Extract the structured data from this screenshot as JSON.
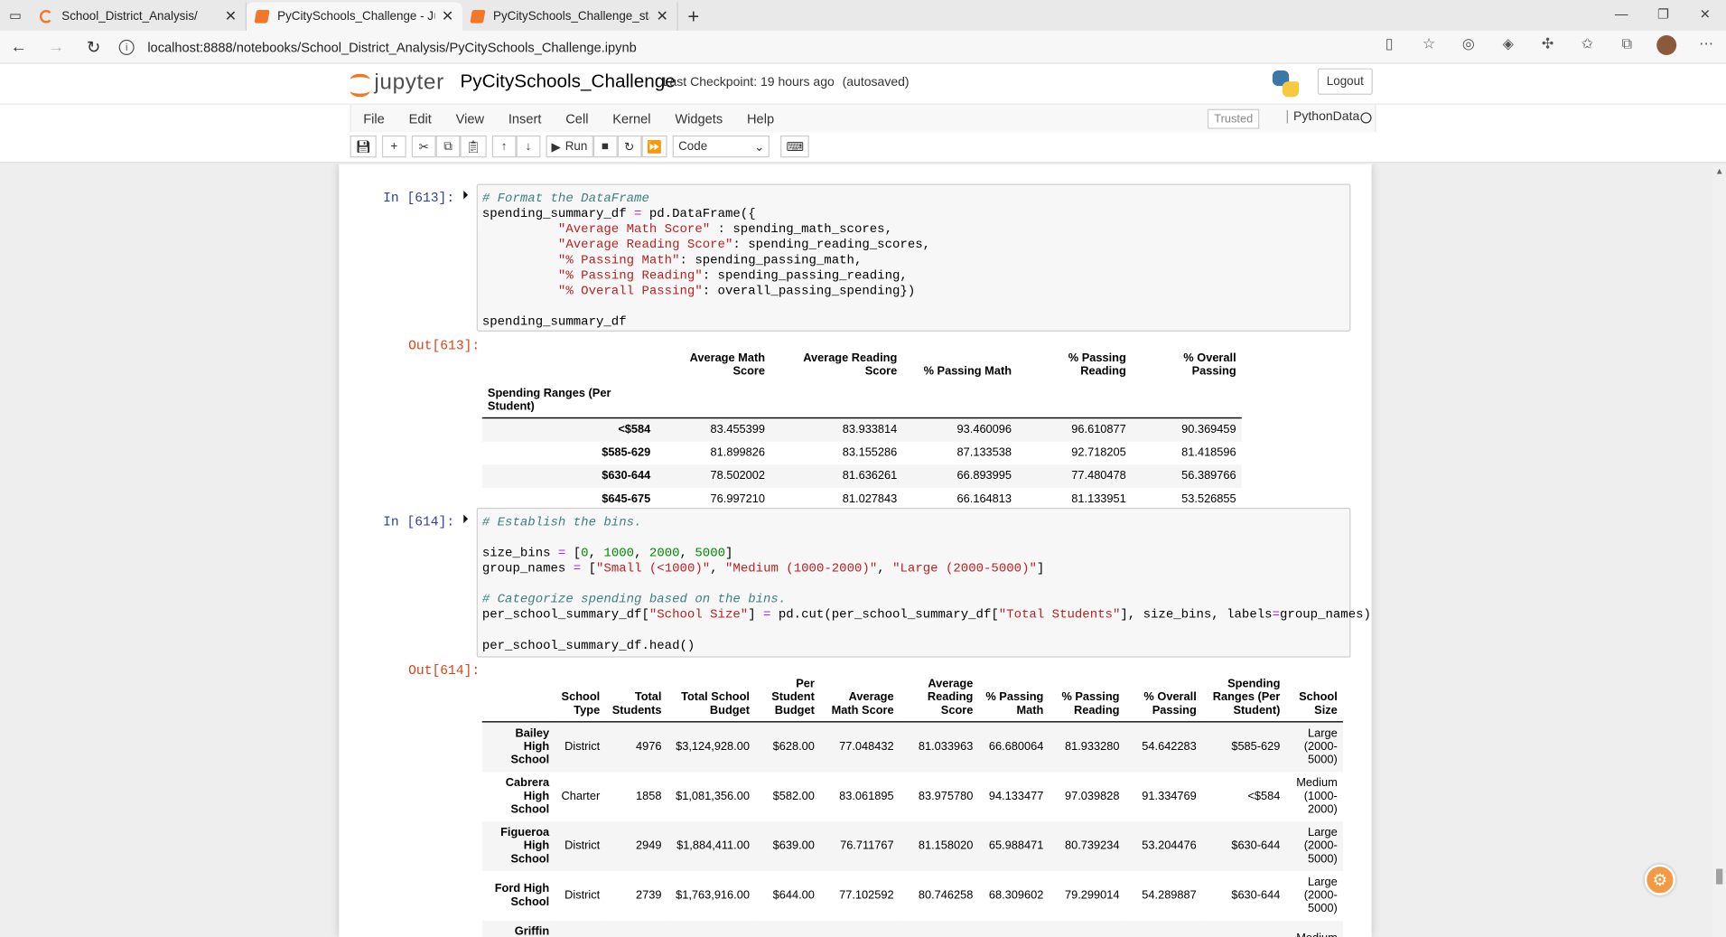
{
  "browser": {
    "tabs": [
      {
        "title": "School_District_Analysis/",
        "icon": "jupyter-icon"
      },
      {
        "title": "PyCitySchools_Challenge - Jupyter",
        "icon": "notebook-icon"
      },
      {
        "title": "PyCitySchools_Challenge_starter",
        "icon": "notebook-icon"
      }
    ],
    "url": "localhost:8888/notebooks/School_District_Analysis/PyCitySchools_Challenge.ipynb"
  },
  "jupyter": {
    "logo_text": "jupyter",
    "notebook_name": "PyCitySchools_Challenge",
    "checkpoint": "Last Checkpoint: 19 hours ago",
    "autosave": "(autosaved)",
    "logout": "Logout",
    "menu": [
      "File",
      "Edit",
      "View",
      "Insert",
      "Cell",
      "Kernel",
      "Widgets",
      "Help"
    ],
    "trusted": "Trusted",
    "kernel_name": "PythonData",
    "run_label": "Run",
    "cell_type": "Code"
  },
  "cells": {
    "c613": {
      "in_prompt": "In [613]:",
      "out_prompt": "Out[613]:"
    },
    "c614": {
      "in_prompt": "In [614]:",
      "out_prompt": "Out[614]:"
    }
  },
  "table613": {
    "columns": [
      "Average Math Score",
      "Average Reading Score",
      "% Passing Math",
      "% Passing Reading",
      "% Overall Passing"
    ],
    "index_name": "Spending Ranges (Per Student)",
    "rows": [
      {
        "idx": "<$584",
        "vals": [
          "83.455399",
          "83.933814",
          "93.460096",
          "96.610877",
          "90.369459"
        ]
      },
      {
        "idx": "$585-629",
        "vals": [
          "81.899826",
          "83.155286",
          "87.133538",
          "92.718205",
          "81.418596"
        ]
      },
      {
        "idx": "$630-644",
        "vals": [
          "78.502002",
          "81.636261",
          "66.893995",
          "77.480478",
          "56.389766"
        ]
      },
      {
        "idx": "$645-675",
        "vals": [
          "76.997210",
          "81.027843",
          "66.164813",
          "81.133951",
          "53.526855"
        ]
      }
    ]
  },
  "table614": {
    "columns": [
      "School Type",
      "Total Students",
      "Total School Budget",
      "Per Student Budget",
      "Average Math Score",
      "Average Reading Score",
      "% Passing Math",
      "% Passing Reading",
      "% Overall Passing",
      "Spending Ranges (Per Student)",
      "School Size"
    ],
    "rows": [
      {
        "idx": "Bailey High School",
        "vals": [
          "District",
          "4976",
          "$3,124,928.00",
          "$628.00",
          "77.048432",
          "81.033963",
          "66.680064",
          "81.933280",
          "54.642283",
          "$585-629",
          "Large (2000-5000)"
        ]
      },
      {
        "idx": "Cabrera High School",
        "vals": [
          "Charter",
          "1858",
          "$1,081,356.00",
          "$582.00",
          "83.061895",
          "83.975780",
          "94.133477",
          "97.039828",
          "91.334769",
          "<$584",
          "Medium (1000-2000)"
        ]
      },
      {
        "idx": "Figueroa High School",
        "vals": [
          "District",
          "2949",
          "$1,884,411.00",
          "$639.00",
          "76.711767",
          "81.158020",
          "65.988471",
          "80.739234",
          "53.204476",
          "$630-644",
          "Large (2000-5000)"
        ]
      },
      {
        "idx": "Ford High School",
        "vals": [
          "District",
          "2739",
          "$1,763,916.00",
          "$644.00",
          "77.102592",
          "80.746258",
          "68.309602",
          "79.299014",
          "54.289887",
          "$630-644",
          "Large (2000-5000)"
        ]
      },
      {
        "idx": "Griffin High",
        "vals": [
          "",
          "",
          "",
          "",
          "",
          "",
          "",
          "",
          "",
          "",
          "Medium"
        ]
      }
    ]
  }
}
